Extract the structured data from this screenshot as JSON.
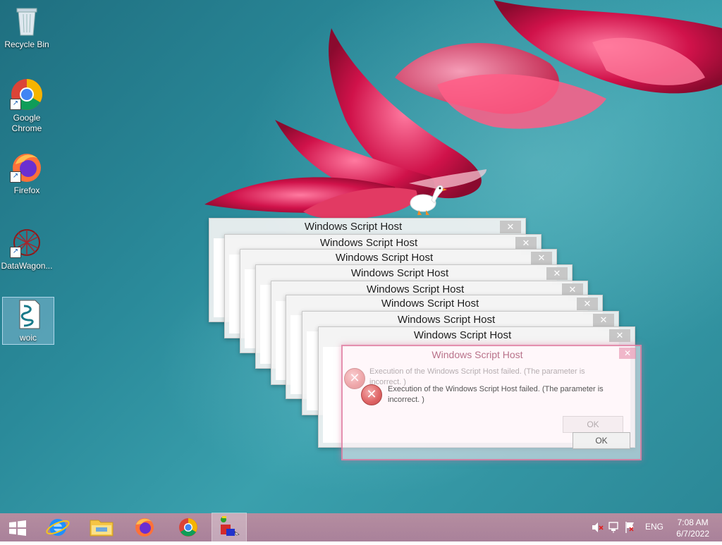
{
  "desktop": {
    "icons": [
      {
        "label": "Recycle Bin"
      },
      {
        "label": "Google Chrome"
      },
      {
        "label": "Firefox"
      },
      {
        "label": "DataWagon..."
      },
      {
        "label": "woic"
      }
    ]
  },
  "dialogs": {
    "title": "Windows Script Host",
    "close_glyph": "✕",
    "message": "Execution of the Windows Script Host failed. (The parameter is incorrect. )",
    "ok_label": "OK"
  },
  "taskbar": {
    "items": [
      {
        "icon": "windows-start-icon"
      },
      {
        "icon": "internet-explorer-icon"
      },
      {
        "icon": "file-explorer-icon"
      },
      {
        "icon": "firefox-icon"
      },
      {
        "icon": "chrome-icon"
      },
      {
        "icon": "script-app-icon"
      }
    ],
    "language": "ENG",
    "time": "7:08 AM",
    "date": "6/7/2022"
  },
  "colors": {
    "accent": "#e24a7a",
    "taskbar": "#b08b9f",
    "error": "#d94a4a"
  }
}
